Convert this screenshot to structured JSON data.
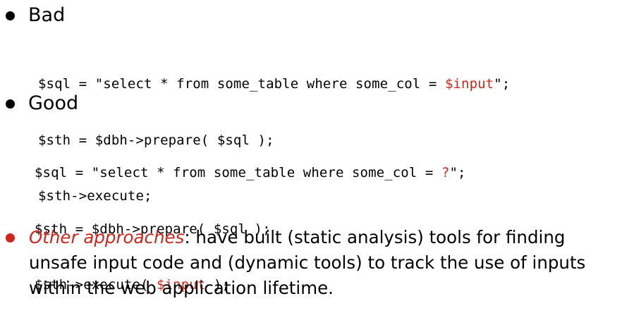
{
  "bad": {
    "heading": "Bad",
    "code": [
      {
        "pre": "$sql = \"select * from some_table where some_col = ",
        "var": "$input",
        "post": "\";"
      },
      {
        "pre": "$sth = $dbh->prepare( $sql );",
        "var": "",
        "post": ""
      },
      {
        "pre": "$sth->execute;",
        "var": "",
        "post": ""
      }
    ]
  },
  "good": {
    "heading": "Good",
    "code": [
      {
        "pre": "$sql = \"select * from some_table where some_col = ",
        "var": "?",
        "post": "\";"
      },
      {
        "pre": "$sth = $dbh->prepare( $sql );",
        "var": "",
        "post": ""
      },
      {
        "pre": "$sth->execute( ",
        "var": "$input",
        "post": " );"
      }
    ]
  },
  "other": {
    "lead": "Other approaches",
    "text": ": have built (static analysis) tools for finding unsafe input code and (dynamic tools) to track the use of inputs within the web application lifetime."
  },
  "colors": {
    "accent": "#d0251b",
    "text": "#000000"
  }
}
